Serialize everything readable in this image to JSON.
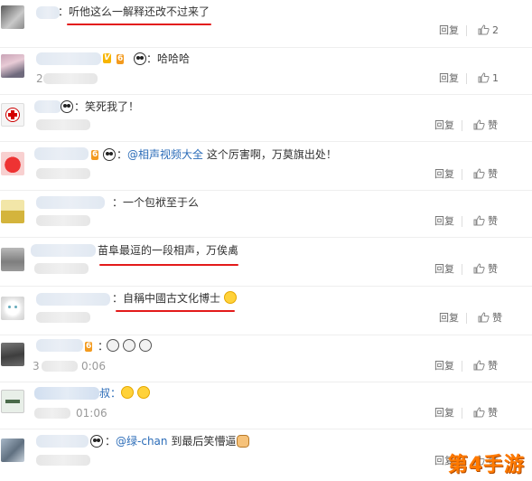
{
  "comments": [
    {
      "text": "：听他这么一解释还改不过来了",
      "reply_label": "回复",
      "like_count": "2"
    },
    {
      "text": "：哈哈哈",
      "time": "2",
      "reply_label": "回复",
      "like_count": "1"
    },
    {
      "text": "：笑死我了！",
      "reply_label": "回复",
      "like_label": "赞"
    },
    {
      "text_prefix": "：",
      "mention": "@相声视频大全",
      "text_suffix": " 这个厉害啊，万莫旗出处！",
      "reply_label": "回复",
      "like_label": "赞"
    },
    {
      "text": "：一个包袱至于么",
      "reply_label": "回复",
      "like_label": "赞"
    },
    {
      "text": "苗阜最逗的一段相声，万俟禼",
      "reply_label": "回复",
      "like_label": "赞"
    },
    {
      "text": "：自稱中國古文化博士",
      "reply_label": "回复",
      "like_label": "赞"
    },
    {
      "text": "：",
      "time": "3",
      "time2": "0:06",
      "reply_label": "回复",
      "like_label": "赞"
    },
    {
      "text": "叔：",
      "time": "01:06",
      "reply_label": "回复",
      "like_label": "赞"
    },
    {
      "text_prefix": "：",
      "mention": "@绿-chan",
      "text_suffix": " 到最后笑懵逼",
      "reply_label": "回复",
      "like_label": "赞"
    }
  ],
  "watermark": "第4手游",
  "colors": {
    "underline": "#e31a1a",
    "mention": "#2b6cb8",
    "watermark": "#ff7a00"
  }
}
